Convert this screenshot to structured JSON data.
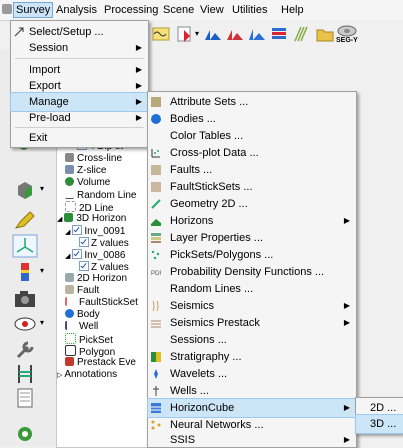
{
  "menubar": {
    "items": [
      "Survey",
      "Analysis",
      "Processing",
      "Scene",
      "View",
      "Utilities",
      "Help"
    ]
  },
  "toolbar": {
    "segy_label": "SEG-Y"
  },
  "survey_menu": {
    "items": [
      "Select/Setup ...",
      "Session",
      "Import",
      "Export",
      "Manage",
      "Pre-load",
      "Exit"
    ]
  },
  "manage_menu": {
    "items": [
      "Attribute Sets ...",
      "Bodies ...",
      "Color Tables ...",
      "Cross-plot Data ...",
      "Faults ...",
      "FaultStickSets ...",
      "Geometry 2D ...",
      "Horizons",
      "Layer Properties ...",
      "PickSets/Polygons ...",
      "Probability Density Functions ...",
      "Random Lines ...",
      "Seismics",
      "Seismics Prestack",
      "Sessions ...",
      "Stratigraphy ...",
      "Wavelets ...",
      "Wells ...",
      "HorizonCube",
      "Neural Networks ...",
      "SSIS"
    ]
  },
  "horizoncube_menu": {
    "items": [
      "2D ...",
      "3D ..."
    ]
  },
  "tree": {
    "items": [
      "4 Dip st",
      "Cross-line",
      "Z-slice",
      "Volume",
      "Random Line",
      "2D Line",
      "3D Horizon",
      "Inv_0091",
      "Z values",
      "Inv_0086",
      "Z values",
      "2D Horizon",
      "Fault",
      "FaultStickSet",
      "Body",
      "Well",
      "PickSet",
      "Polygon",
      "Prestack Eve",
      "Annotations"
    ]
  }
}
